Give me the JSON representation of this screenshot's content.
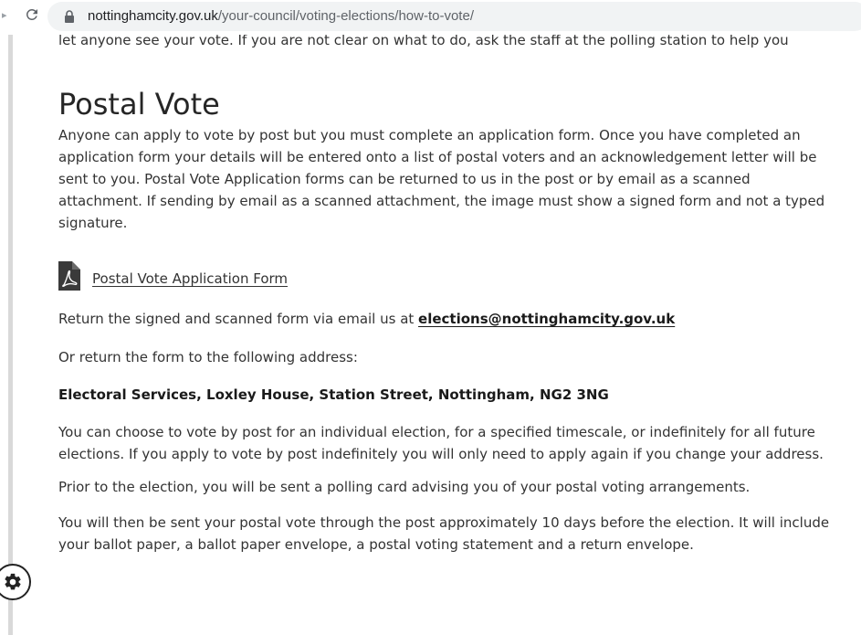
{
  "browser": {
    "url_domain": "nottinghamcity.gov.uk",
    "url_path": "/your-council/voting-elections/how-to-vote/"
  },
  "page": {
    "intro_text": "let anyone see your vote. If you are not clear on what to do, ask the staff at the polling station to help you",
    "section_title": "Postal Vote",
    "para1": "Anyone can apply to vote by post but you must complete an application form. Once you have completed an application form your details will be entered onto a list of postal voters and an acknowledgement letter will be sent to you. Postal Vote Application forms can be returned to us in the post or by email as a scanned attachment. If sending by email as a scanned attachment, the image must show a signed form and not a typed signature.",
    "download_link": "Postal Vote Application Form",
    "return_text": "Return the signed and scanned form via email us at ",
    "return_email": "elections@nottinghamcity.gov.uk",
    "or_text": "Or return the form to the following address:",
    "address": "Electoral Services, Loxley House, Station Street, Nottingham, NG2 3NG",
    "choose_text": "You can choose to vote by post for an individual election, for a specified timescale, or indefinitely for all future elections. If you apply to vote by post indefinitely you will only need to apply again if you change your address.",
    "prior_text": "Prior to the election, you will be sent a polling card advising you of your postal voting arrangements.",
    "sent_text": "You will then be sent your postal vote through the post approximately 10 days before the election. It will include your ballot paper, a ballot paper envelope, a postal voting statement and a return envelope."
  },
  "icons": {
    "reload": "reload-icon",
    "lock": "lock-icon",
    "pdf": "pdf-file-icon",
    "settings": "gear-icon"
  },
  "colors": {
    "text": "#333333",
    "heading": "#262626",
    "omnibox": "#f1f3f4",
    "rule": "#d9d9d9"
  }
}
